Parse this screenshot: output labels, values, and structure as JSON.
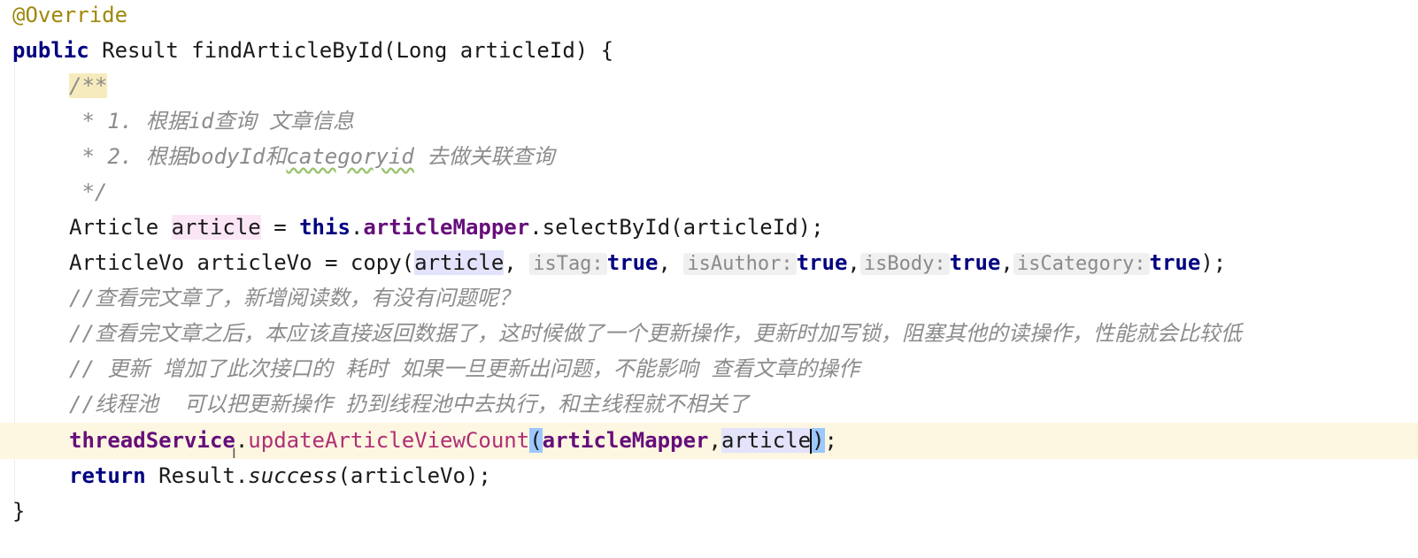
{
  "lines": {
    "l1": {
      "annotation": "@Override"
    },
    "l2": {
      "kw_public": "public",
      "text": " Result findArticleById(Long articleId) {"
    },
    "l3": {
      "doc_start": "/**"
    },
    "l4": {
      "text": " * 1. 根据id查询 文章信息"
    },
    "l5": {
      "prefix": " * 2. 根据bodyId和",
      "typo": "categoryid",
      "suffix": " 去做关联查询"
    },
    "l6": {
      "text": " */"
    },
    "l7": {
      "type": "Article ",
      "var": "article",
      "assign": " = ",
      "kw_this": "this",
      "dot": ".",
      "field": "articleMapper",
      "call": ".selectById(articleId);"
    },
    "l8": {
      "prefix": "ArticleVo articleVo = copy(",
      "arg": "article",
      "comma": ", ",
      "hint_istag": "isTag:",
      "hint_isauthor": "isAuthor:",
      "hint_isbody": "isBody:",
      "hint_iscategory": "isCategory:",
      "kw_true": "true",
      "sep": ",",
      "end": ");"
    },
    "l9": {
      "text": "//查看完文章了，新增阅读数，有没有问题呢？"
    },
    "l10": {
      "text": "//查看完文章之后，本应该直接返回数据了，这时候做了一个更新操作，更新时加写锁，阻塞其他的读操作，性能就会比较低"
    },
    "l11": {
      "text": "// 更新 增加了此次接口的 耗时 如果一旦更新出问题，不能影响 查看文章的操作"
    },
    "l12": {
      "text": "//线程池  可以把更新操作 扔到线程池中去执行，和主线程就不相关了"
    },
    "l13": {
      "field": "threadService",
      "dot": ".",
      "method": "updateArticleViewCount",
      "open": "(",
      "arg1": "articleMapper",
      "comma": ",",
      "arg2": "article",
      "close": ")",
      "end": ";"
    },
    "l14": {
      "kw_return": "return",
      "pre": " Result.",
      "static_call": "success",
      "post": "(articleVo);"
    },
    "l15": {
      "text": "}"
    }
  },
  "icons": {
    "cursor": "i-beam-cursor-icon"
  },
  "colors": {
    "keyword": "#000080",
    "field": "#660e7a",
    "annotation": "#9e880d",
    "comment": "#8c8c8c",
    "method_reference": "#b02e76",
    "current_line": "#fdf6e0"
  }
}
